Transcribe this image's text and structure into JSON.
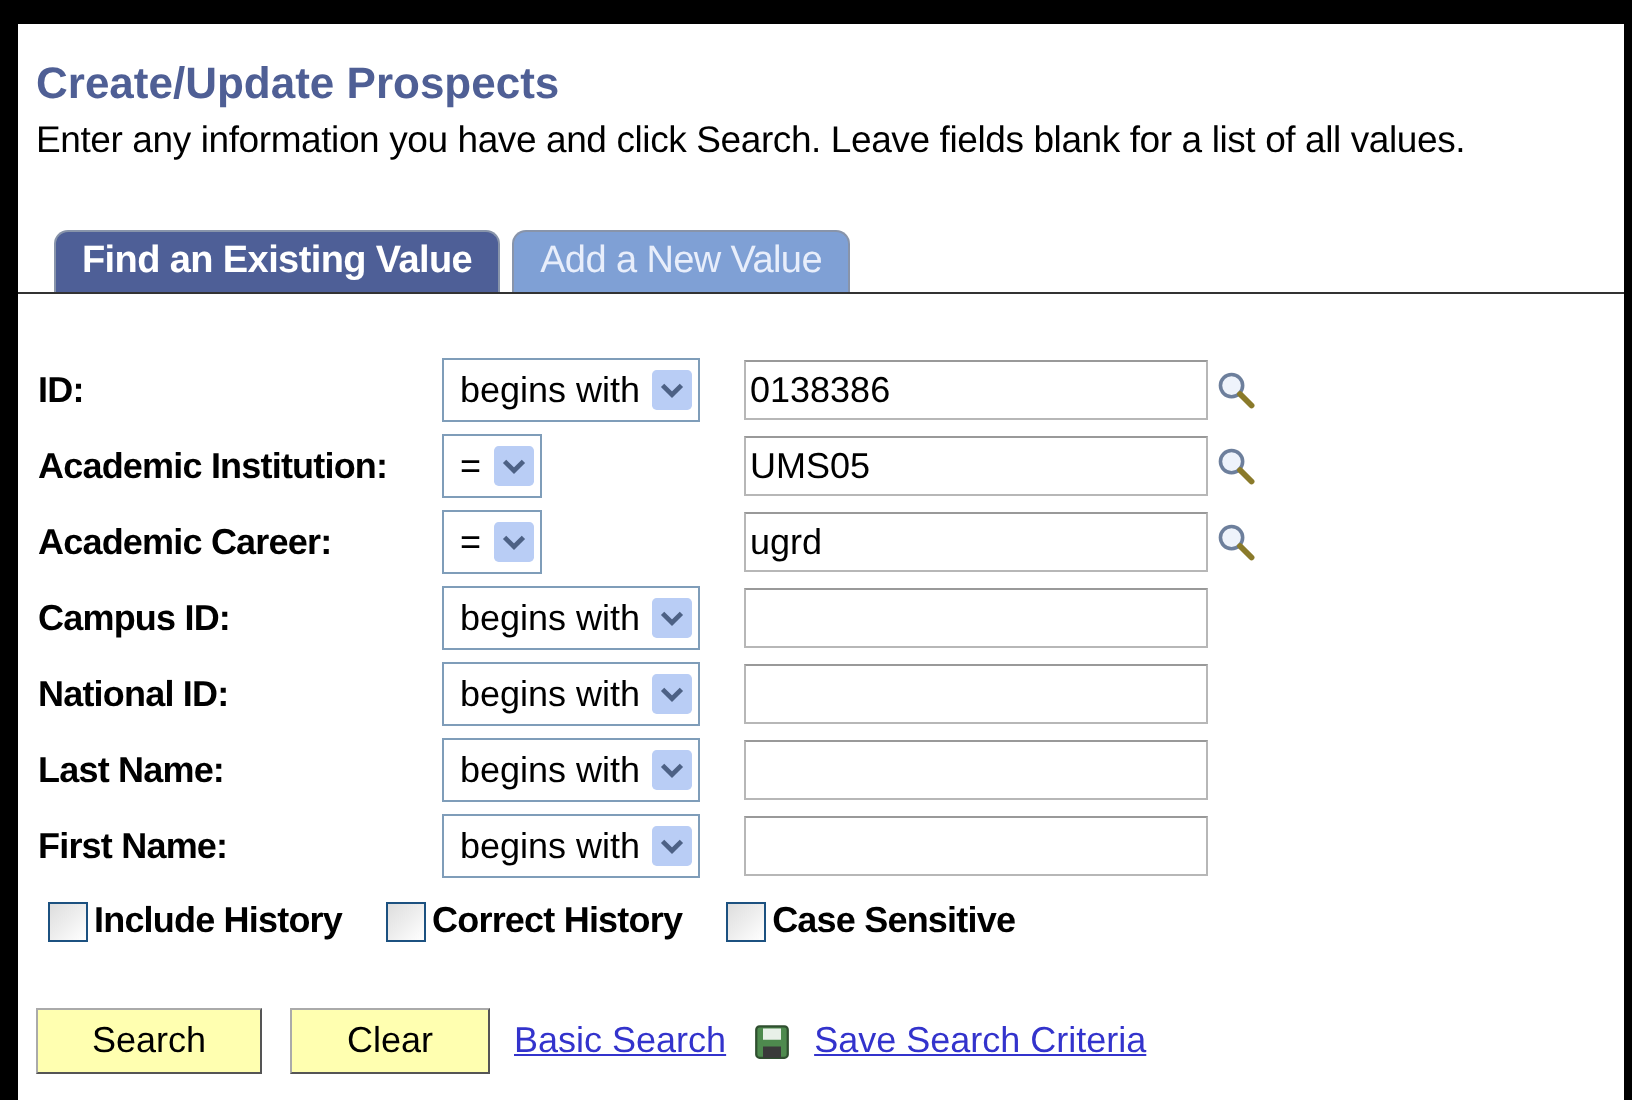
{
  "title": "Create/Update Prospects",
  "instructions": "Enter any information you have and click Search. Leave fields blank for a list of all values.",
  "tabs": [
    {
      "label": "Find an Existing Value",
      "selected": true
    },
    {
      "label": "Add a New Value",
      "selected": false
    }
  ],
  "fields": [
    {
      "label": "ID:",
      "operator": "begins with",
      "value": "0138386",
      "lookup": true
    },
    {
      "label": "Academic Institution:",
      "operator": "=",
      "value": "UMS05",
      "lookup": true
    },
    {
      "label": "Academic Career:",
      "operator": "=",
      "value": "ugrd",
      "lookup": true
    },
    {
      "label": "Campus ID:",
      "operator": "begins with",
      "lookup": false
    },
    {
      "label": "National ID:",
      "operator": "begins with",
      "lookup": false
    },
    {
      "label": "Last Name:",
      "operator": "begins with",
      "lookup": false
    },
    {
      "label": "First Name:",
      "operator": "begins with",
      "lookup": false
    }
  ],
  "options": [
    {
      "label": "Include History",
      "checked": false
    },
    {
      "label": "Correct History",
      "checked": false
    },
    {
      "label": "Case Sensitive",
      "checked": false
    }
  ],
  "buttons": [
    "Search",
    "Clear"
  ],
  "links": [
    {
      "label": "Basic Search",
      "kind": "plain"
    },
    {
      "label": "Save Search Criteria",
      "kind": "save"
    }
  ]
}
